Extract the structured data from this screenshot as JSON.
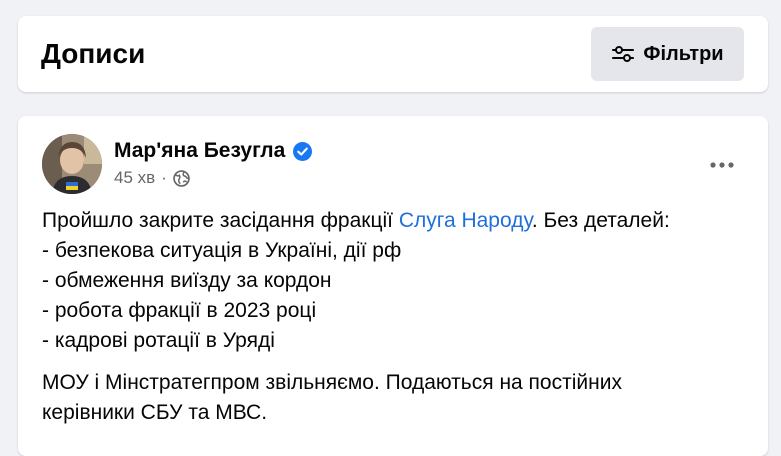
{
  "header": {
    "title": "Дописи",
    "filters_label": "Фільтри"
  },
  "post": {
    "author": "Мар'яна Безугла",
    "time": "45 хв",
    "meta_separator": "·",
    "intro_before": "Пройшло закрите засідання фракції ",
    "intro_link": "Слуга Народу",
    "intro_after": ". Без деталей:",
    "list": [
      "- безпекова ситуація в Україні, дії рф",
      "- обмеження виїзду за кордон",
      "- робота фракції в 2023 році",
      "- кадрові ротації в Уряді"
    ],
    "para2_line1": "МОУ і Мінстратегпром звільняємо. Подаються на постійних",
    "para2_line2": "керівники СБУ та МВС."
  },
  "icons": {
    "filters": "sliders-icon",
    "verified": "verified-badge-icon",
    "audience": "globe-icon",
    "more": "more-horizontal-icon"
  },
  "colors": {
    "background": "#f0f2f5",
    "link": "#216fdb",
    "verified": "#1877f2",
    "secondary_text": "#65676b",
    "button_bg": "#e4e6eb"
  }
}
